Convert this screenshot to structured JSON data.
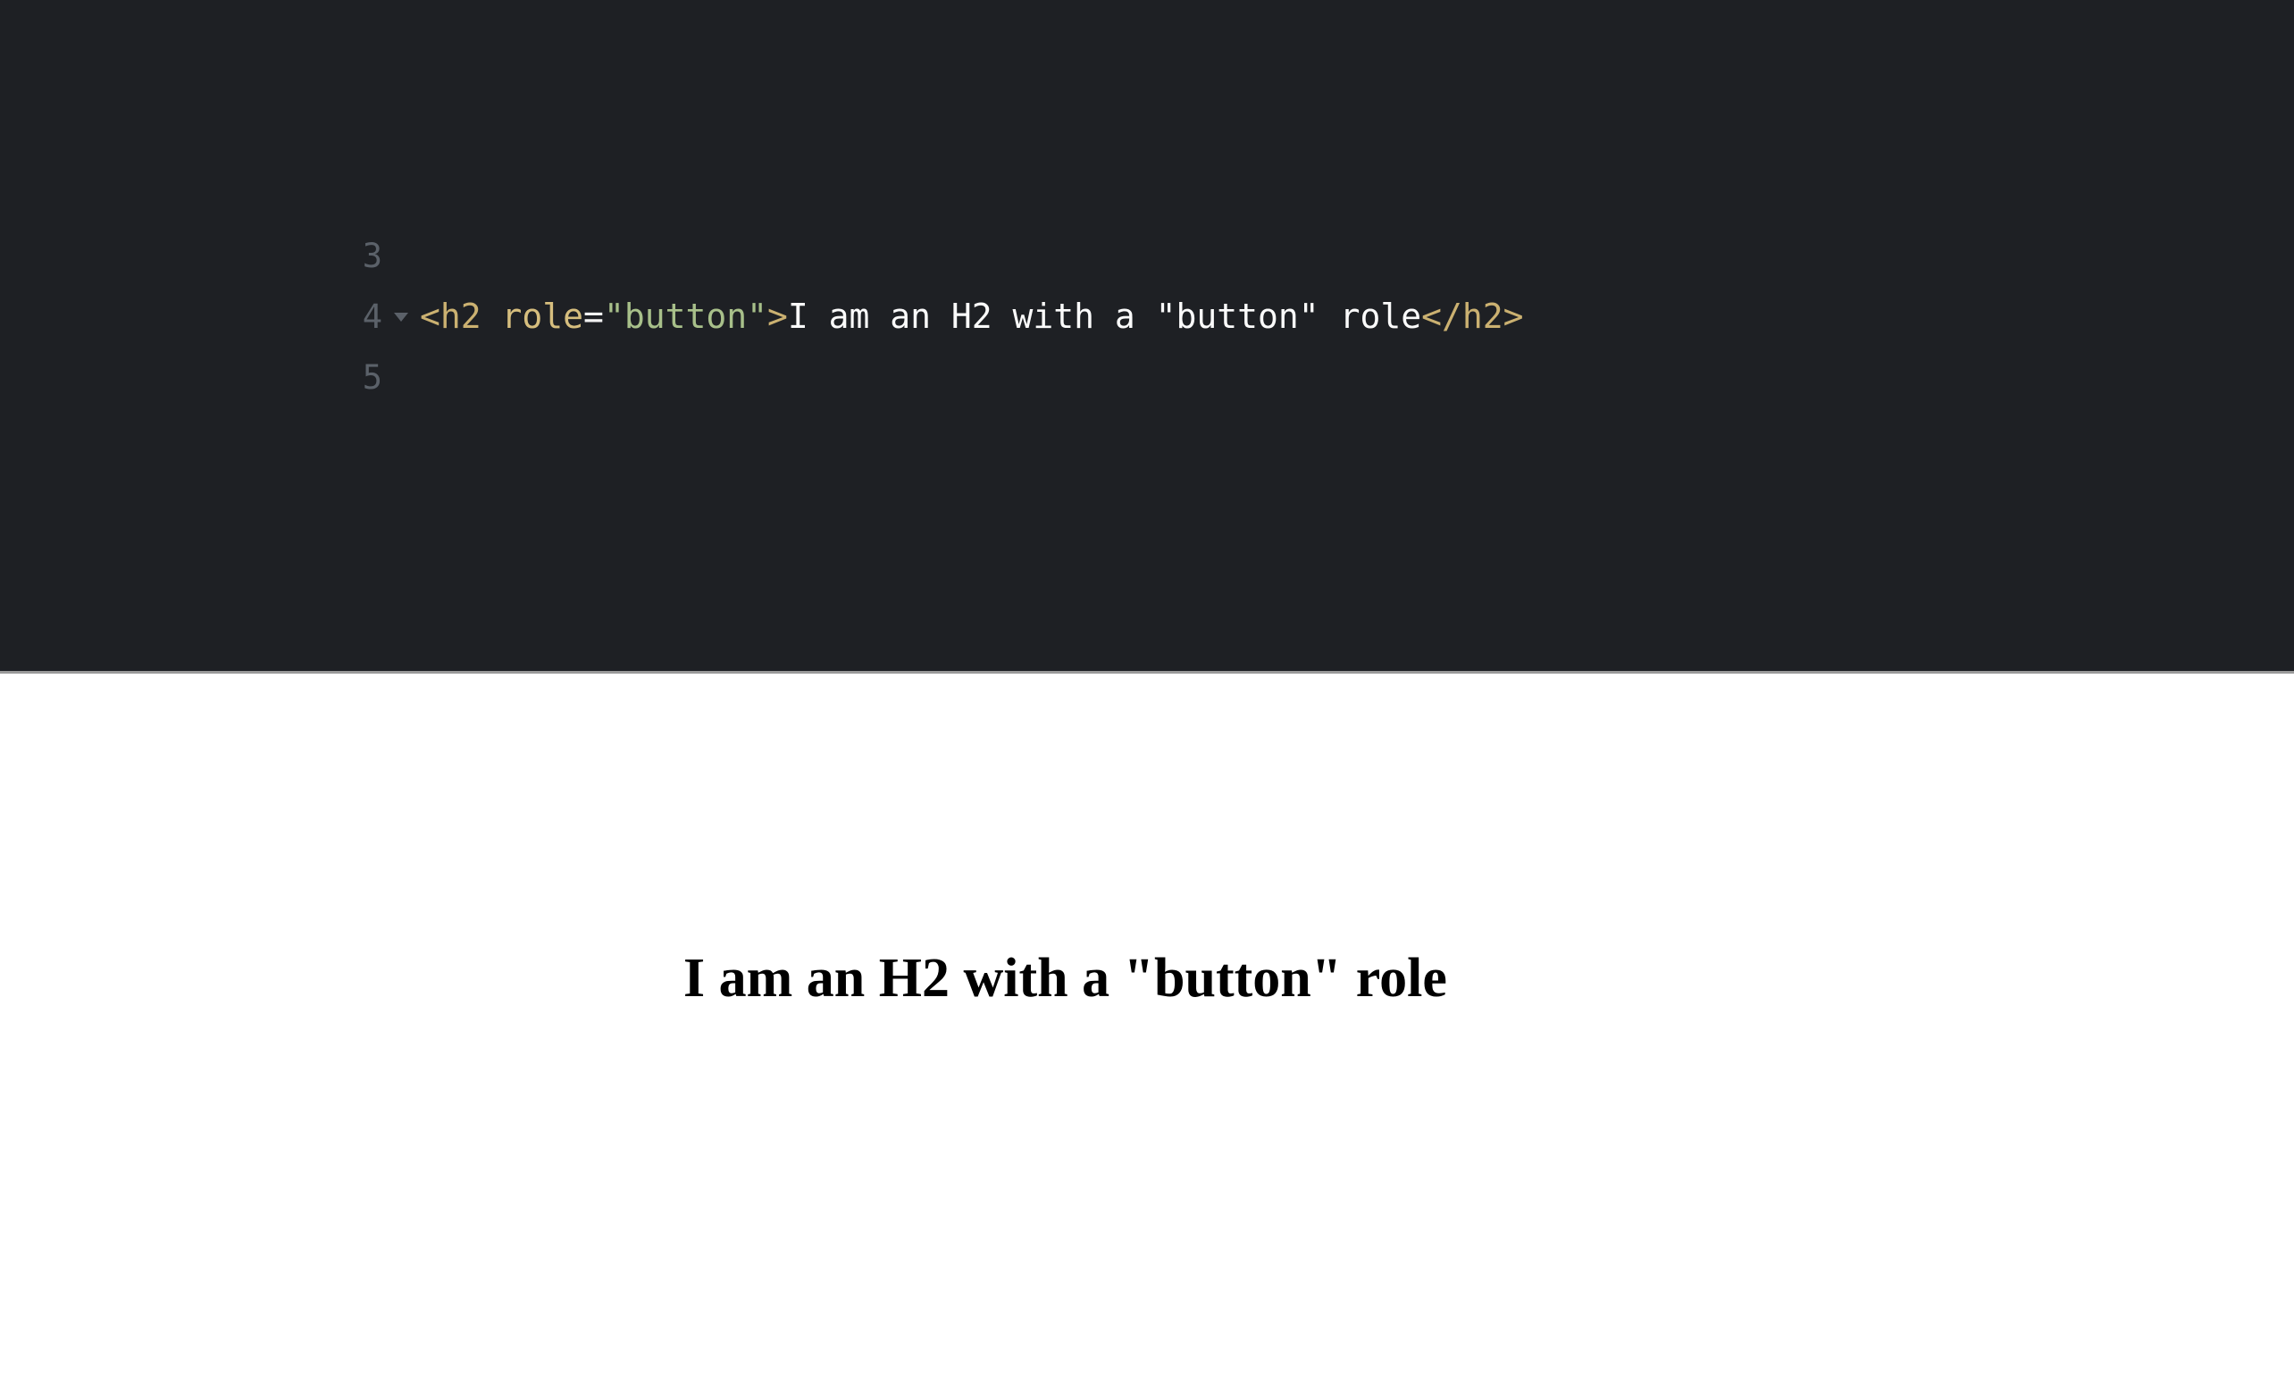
{
  "editor": {
    "background_color": "#1e2024",
    "lines": [
      {
        "number": "3",
        "has_fold_arrow": false,
        "tokens": []
      },
      {
        "number": "4",
        "has_fold_arrow": true,
        "fold_arrow_glyph": "▾",
        "tokens": [
          {
            "kind": "tag",
            "text": "<h2"
          },
          {
            "kind": "plain",
            "text": " "
          },
          {
            "kind": "attr",
            "text": "role"
          },
          {
            "kind": "op",
            "text": "="
          },
          {
            "kind": "string",
            "text": "\"button\""
          },
          {
            "kind": "tag",
            "text": ">"
          },
          {
            "kind": "content",
            "text": "I am an H2 with a \"button\" role"
          },
          {
            "kind": "tag",
            "text": "</h2>"
          }
        ],
        "full_text": "<h2 role=\"button\">I am an H2 with a \"button\" role</h2>"
      },
      {
        "number": "5",
        "has_fold_arrow": false,
        "tokens": []
      }
    ],
    "colors": {
      "line_number": "#5b6169",
      "tag": "#cbb171",
      "attribute": "#d6be7e",
      "operator": "#f2f2f2",
      "string": "#a8c08a",
      "text_content": "#fbfbfb"
    }
  },
  "divider": {
    "color": "#9a9a9a"
  },
  "preview": {
    "background_color": "#ffffff",
    "heading_text": "I am an H2 with a \"button\" role",
    "heading_color": "#000000"
  }
}
